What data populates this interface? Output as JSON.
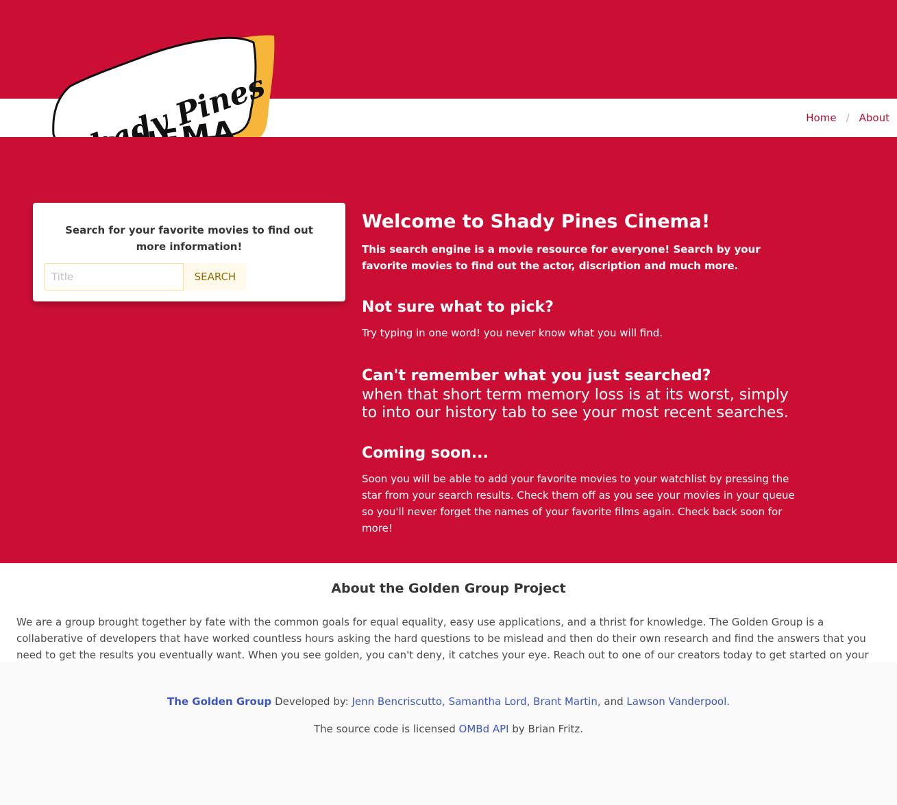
{
  "nav": {
    "breadcrumb": [
      {
        "label": "Home"
      },
      {
        "label": "About"
      }
    ],
    "separator": "/"
  },
  "logo": {
    "line1": "Shady Pines",
    "line2": "CINEMA"
  },
  "search": {
    "prompt": "Search for your favorite movies to find out more information!",
    "placeholder": "Title",
    "button_label": "SEARCH"
  },
  "welcome": {
    "title": "Welcome to Shady Pines Cinema!",
    "intro": "This search engine is a movie resource for everyone! Search by your favorite movies to find out the actor, discription and much more."
  },
  "tips": {
    "pick_title": "Not sure what to pick?",
    "pick_text": "Try typing in one word! you never know what you will find.",
    "remember_title": "Can't remember what you just searched?",
    "remember_text": "when that short term memory loss is at its worst, simply to into our history tab to see your most recent searches.",
    "soon_title": "Coming soon...",
    "soon_text": "Soon you will be able to add your favorite movies to your watchlist by pressing the star from your search results. Check them off as you see your movies in your queue so you'll never forget the names of your favorite films again. Check back soon for more!"
  },
  "about": {
    "title": "About the Golden Group Project",
    "text": "We are a group brought together by fate with the common goals for equal equality, easy use applications, and a thrist for knowledge. The Golden Group is a collaberative of developers that have worked countless hours asking the hard questions to be mislead and then do their own research and find the answers that you need to get the results you eventually want. When you see golden, you can't deny, it catches your eye. Reach out to one of our creators today to get started on your next project."
  },
  "footer": {
    "brand": "The Golden Group",
    "developed_by": "Developed by:",
    "developers": "Jenn Bencriscutto, Samantha Lord, Brant Martin,",
    "and": "and",
    "last_developer": "Lawson Vanderpool.",
    "license_prefix": "The source code is licensed",
    "license_link": "OMBd API",
    "license_suffix": "by Brian Fritz."
  },
  "colors": {
    "hero_red": "#cb0f34",
    "link_red": "#b01030",
    "logo_gold": "#f6b63a",
    "footer_link": "#3e56c4"
  }
}
